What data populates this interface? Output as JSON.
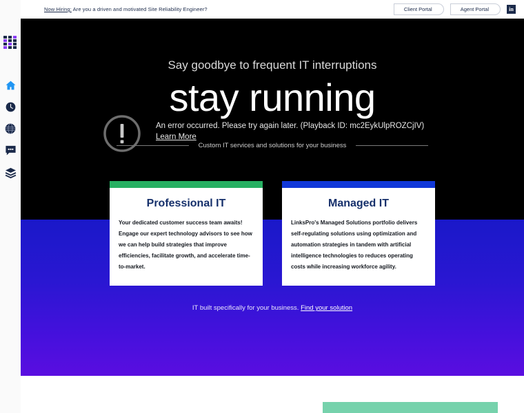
{
  "sidebar": {
    "items": [
      {
        "name": "apps-grid-icon",
        "label": "Apps"
      },
      {
        "name": "home-icon",
        "label": "Home"
      },
      {
        "name": "clock-icon",
        "label": "History"
      },
      {
        "name": "globe-icon",
        "label": "Global"
      },
      {
        "name": "chat-icon",
        "label": "Messages"
      },
      {
        "name": "layers-icon",
        "label": "Layers"
      }
    ]
  },
  "topbar": {
    "hiring_prefix": "Now Hiring:",
    "hiring_text": " Are you a driven and motivated Site Reliability Engineer?",
    "client_portal": "Client Portal",
    "agent_portal": "Agent Portal",
    "linkedin_glyph": "in"
  },
  "hero": {
    "eyebrow": "Say goodbye to frequent IT interruptions",
    "title": "stay running",
    "subtitle": "Custom IT services and solutions for your business",
    "error_message": "An error occurred. Please try again later. (Playback ID: mc2EykUlpROZCjIV)",
    "error_learn_more": "Learn More"
  },
  "cards": [
    {
      "title": "Professional IT",
      "accent": "#27b062",
      "body": "Your dedicated customer success team awaits! Engage our expert technology advisors to see how we can help build strategies that improve efficiencies, facilitate growth, and accelerate time-to-market."
    },
    {
      "title": "Managed IT",
      "accent": "#1138d8",
      "body": "LinksPro's Managed Solutions portfolio delivers self-regulating solutions using optimization and automation strategies in tandem with artificial intelligence technologies to reduces operating costs while increasing workforce agility."
    }
  ],
  "cta": {
    "text": "IT built specifically for your business. ",
    "link": "Find your solution"
  },
  "colors": {
    "hero_background": "#000000",
    "gradient_start": "#1a18c9",
    "gradient_end": "#5a0ee0",
    "card_title": "#16306b",
    "green_block": "#76d2ac",
    "topbar_text": "#1b2a4a"
  }
}
